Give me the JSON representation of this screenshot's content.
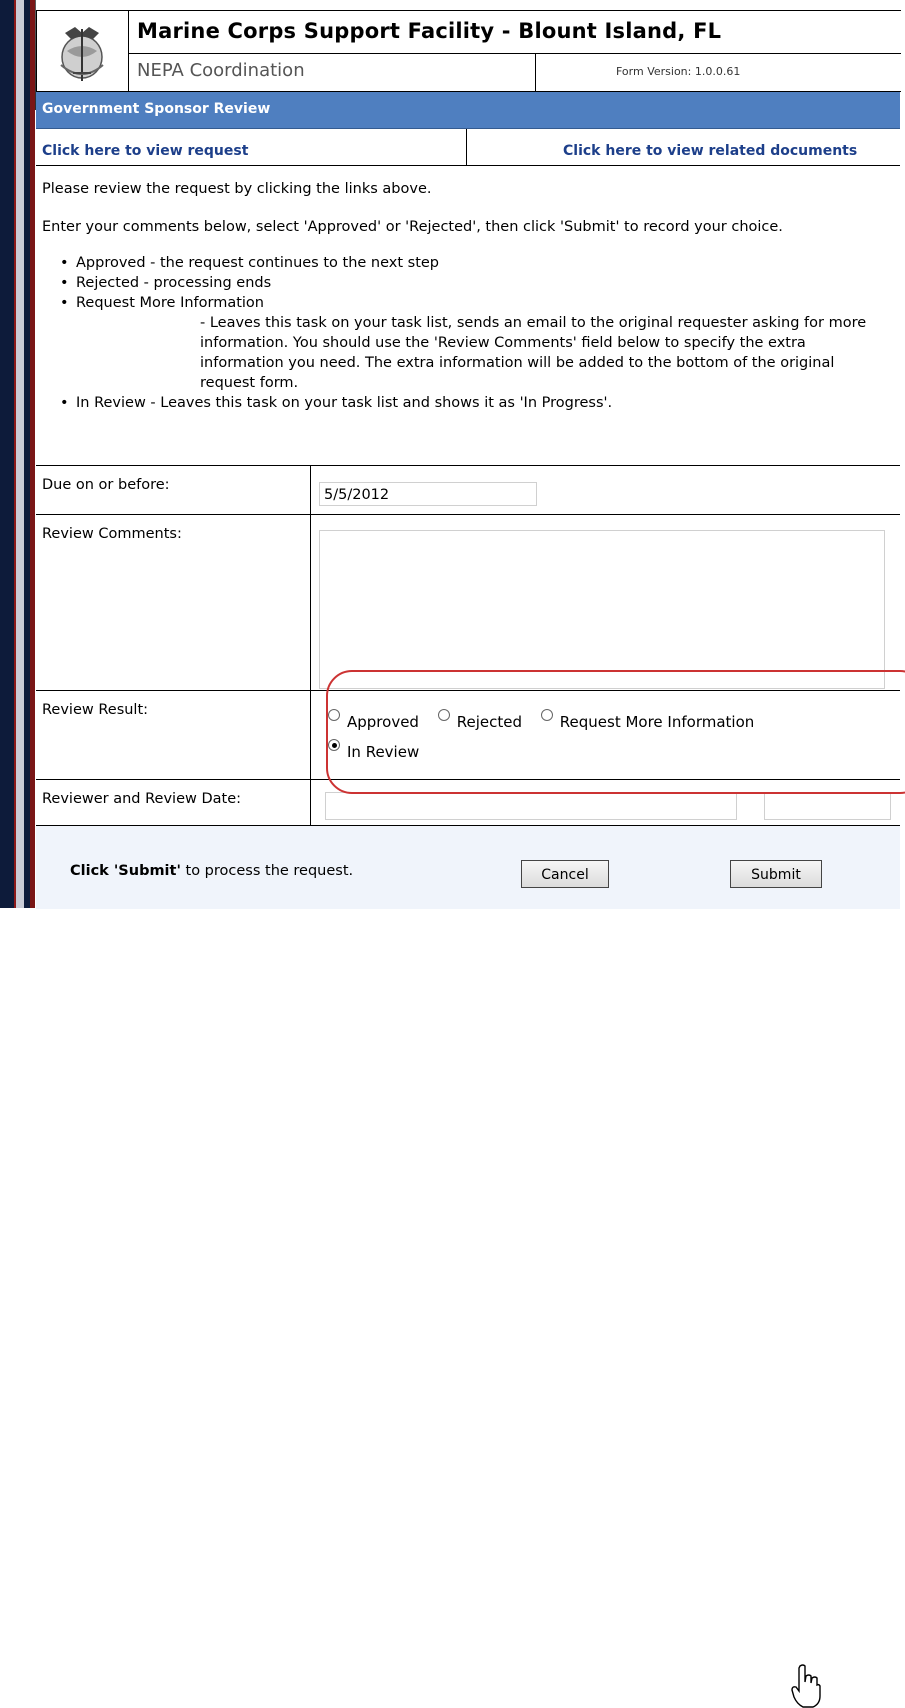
{
  "header": {
    "title": "Marine Corps Support Facility - Blount Island, FL",
    "subtitle": "NEPA Coordination",
    "form_version_label": "Form Version:",
    "form_version": "1.0.0.61"
  },
  "section": {
    "title": "Government Sponsor Review"
  },
  "links": {
    "view_request": "Click here to view request",
    "view_documents": "Click here to view related documents"
  },
  "instructions": {
    "p1": "Please review the request by clicking the links above.",
    "p2": "Enter your comments below, select 'Approved' or 'Rejected', then click 'Submit' to record your choice.",
    "bullets": {
      "approved": "Approved - the request continues to the next step",
      "rejected": "Rejected  - processing ends",
      "request_more": "Request More Information",
      "request_more_detail": "- Leaves this task on your task list, sends an email to the original requester asking for more information. You should use the 'Review Comments' field below to specify the extra information you need. The extra information will be added to the bottom of the original request form.",
      "in_review": "In Review - Leaves this task on your task list and shows it as 'In Progress'."
    }
  },
  "fields": {
    "due_label": "Due on or before:",
    "due_value": "5/5/2012",
    "comments_label": "Review Comments:",
    "comments_value": "",
    "result_label": "Review Result:",
    "result_options": {
      "approved": "Approved",
      "rejected": "Rejected",
      "request_more": "Request More Information",
      "in_review": "In Review"
    },
    "result_selected": "In Review",
    "reviewer_label": "Reviewer and Review Date:",
    "reviewer_value": "",
    "review_date_value": ""
  },
  "footer": {
    "instruction_bold": "Click 'Submit'",
    "instruction_rest": " to process the request.",
    "cancel_label": "Cancel",
    "submit_label": "Submit"
  },
  "colors": {
    "section_bar": "#4f7fc0",
    "link": "#1d3f8a",
    "highlight": "#cc3333",
    "footer_bg": "#f0f4fb"
  }
}
